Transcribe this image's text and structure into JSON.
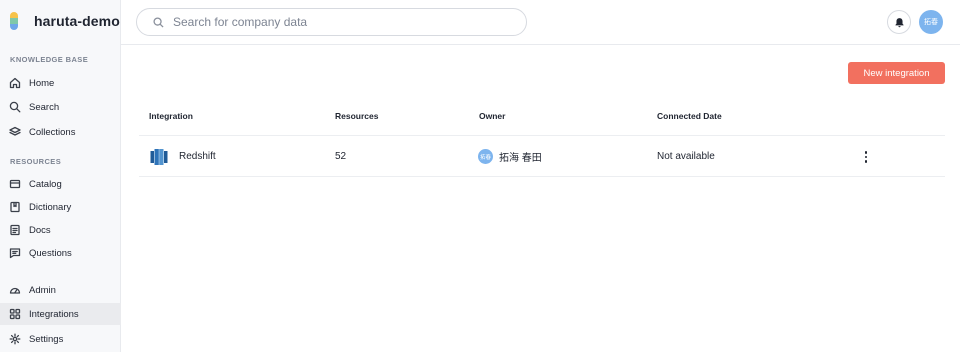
{
  "app": {
    "workspace": "haruta-demo"
  },
  "colors": {
    "accent": "#f2705f",
    "avatar": "#7db4ee",
    "sidebar_bg": "#f7f8fa"
  },
  "sidebar": {
    "knowledge_label": "KNOWLEDGE BASE",
    "resources_label": "RESOURCES",
    "items": [
      {
        "label": "Home",
        "icon": "home-icon"
      },
      {
        "label": "Search",
        "icon": "search-icon"
      },
      {
        "label": "Collections",
        "icon": "collections-icon"
      },
      {
        "label": "Catalog",
        "icon": "catalog-icon"
      },
      {
        "label": "Dictionary",
        "icon": "dictionary-icon"
      },
      {
        "label": "Docs",
        "icon": "docs-icon"
      },
      {
        "label": "Questions",
        "icon": "questions-icon"
      },
      {
        "label": "Admin",
        "icon": "admin-icon"
      },
      {
        "label": "Integrations",
        "icon": "integrations-icon",
        "active": true
      },
      {
        "label": "Settings",
        "icon": "settings-icon"
      }
    ]
  },
  "header": {
    "search_placeholder": "Search for company data",
    "user_initials": "拓春"
  },
  "main": {
    "new_button": "New integration",
    "table": {
      "columns": [
        "Integration",
        "Resources",
        "Owner",
        "Connected Date"
      ],
      "rows": [
        {
          "integration": "Redshift",
          "resources": "52",
          "owner_initials": "拓春",
          "owner": "拓海 春田",
          "connected_date": "Not available"
        }
      ]
    }
  }
}
